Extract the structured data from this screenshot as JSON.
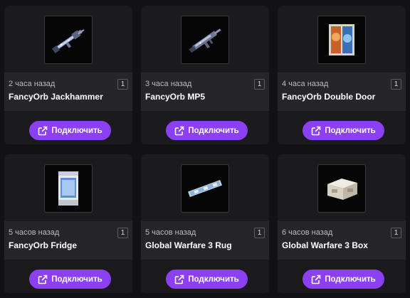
{
  "items": [
    {
      "time": "2 часа назад",
      "name": "FancyOrb Jackhammer",
      "qty": "1",
      "icon": "rifle-icon",
      "button": "Подключить"
    },
    {
      "time": "3 часа назад",
      "name": "FancyOrb MP5",
      "qty": "1",
      "icon": "smg-icon",
      "button": "Подключить"
    },
    {
      "time": "4 часа назад",
      "name": "FancyOrb Double Door",
      "qty": "1",
      "icon": "door-icon",
      "button": "Подключить"
    },
    {
      "time": "5 часов назад",
      "name": "FancyOrb Fridge",
      "qty": "1",
      "icon": "fridge-icon",
      "button": "Подключить"
    },
    {
      "time": "5 часов назад",
      "name": "Global Warfare 3 Rug",
      "qty": "1",
      "icon": "rug-icon",
      "button": "Подключить"
    },
    {
      "time": "6 часов назад",
      "name": "Global Warfare 3 Box",
      "qty": "1",
      "icon": "box-icon",
      "button": "Подключить"
    }
  ],
  "colors": {
    "accent": "#8c3ff3",
    "card": "#1b1b1e",
    "info": "#26262a",
    "background": "#121214"
  }
}
